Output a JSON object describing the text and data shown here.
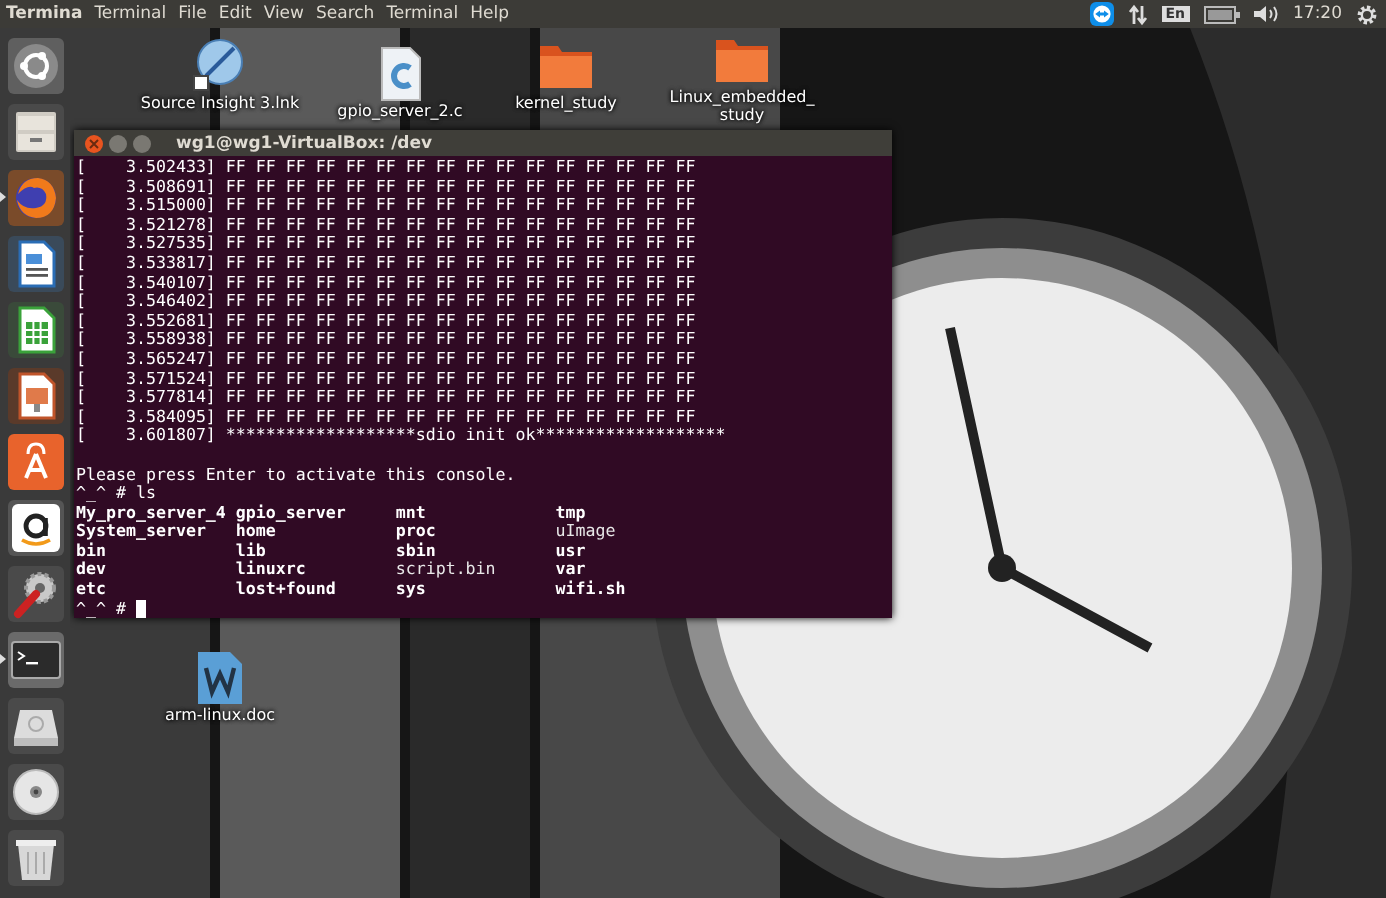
{
  "top_bar": {
    "app_name": "Termina",
    "menus": [
      "Terminal",
      "File",
      "Edit",
      "View",
      "Search",
      "Terminal",
      "Help"
    ],
    "keyboard": "En",
    "clock": "17:20"
  },
  "launcher": [
    {
      "running": false
    },
    {
      "running": false
    },
    {
      "running": true
    },
    {
      "running": false
    },
    {
      "running": false
    },
    {
      "running": false
    },
    {
      "running": false
    },
    {
      "running": false
    },
    {
      "running": false
    },
    {
      "running": true
    },
    {
      "running": false
    },
    {
      "running": false
    },
    {
      "running": false
    }
  ],
  "desktop_icons": [
    {
      "kind": "app",
      "label": "Source Insight 3.lnk"
    },
    {
      "kind": "source",
      "label": "gpio_server_2.c"
    },
    {
      "kind": "folder",
      "label": "kernel_study"
    },
    {
      "kind": "folder",
      "label": "Linux_embedded_ study"
    },
    {
      "kind": "doc",
      "label": "arm-linux.doc"
    }
  ],
  "terminal": {
    "title": "wg1@wg1-VirtualBox: /dev",
    "log": [
      "[    3.502433] FF FF FF FF FF FF FF FF FF FF FF FF FF FF FF FF",
      "[    3.508691] FF FF FF FF FF FF FF FF FF FF FF FF FF FF FF FF",
      "[    3.515000] FF FF FF FF FF FF FF FF FF FF FF FF FF FF FF FF",
      "[    3.521278] FF FF FF FF FF FF FF FF FF FF FF FF FF FF FF FF",
      "[    3.527535] FF FF FF FF FF FF FF FF FF FF FF FF FF FF FF FF",
      "[    3.533817] FF FF FF FF FF FF FF FF FF FF FF FF FF FF FF FF",
      "[    3.540107] FF FF FF FF FF FF FF FF FF FF FF FF FF FF FF FF",
      "[    3.546402] FF FF FF FF FF FF FF FF FF FF FF FF FF FF FF FF",
      "[    3.552681] FF FF FF FF FF FF FF FF FF FF FF FF FF FF FF FF",
      "[    3.558938] FF FF FF FF FF FF FF FF FF FF FF FF FF FF FF FF",
      "[    3.565247] FF FF FF FF FF FF FF FF FF FF FF FF FF FF FF FF",
      "[    3.571524] FF FF FF FF FF FF FF FF FF FF FF FF FF FF FF FF",
      "[    3.577814] FF FF FF FF FF FF FF FF FF FF FF FF FF FF FF FF",
      "[    3.584095] FF FF FF FF FF FF FF FF FF FF FF FF FF FF FF FF",
      "[    3.601807] *******************sdio init ok*******************"
    ],
    "message": "Please press Enter to activate this console.",
    "command": "^_^ # ls",
    "listing": [
      [
        {
          "text": "My_pro_server_4",
          "bold": true
        },
        {
          "text": "gpio_server",
          "bold": true
        },
        {
          "text": "mnt",
          "bold": true
        },
        {
          "text": "tmp",
          "bold": true
        }
      ],
      [
        {
          "text": "System_server",
          "bold": true
        },
        {
          "text": "home",
          "bold": true
        },
        {
          "text": "proc",
          "bold": true
        },
        {
          "text": "uImage",
          "bold": false
        }
      ],
      [
        {
          "text": "bin",
          "bold": true
        },
        {
          "text": "lib",
          "bold": true
        },
        {
          "text": "sbin",
          "bold": true
        },
        {
          "text": "usr",
          "bold": true
        }
      ],
      [
        {
          "text": "dev",
          "bold": true
        },
        {
          "text": "linuxrc",
          "bold": true
        },
        {
          "text": "script.bin",
          "bold": false
        },
        {
          "text": "var",
          "bold": true
        }
      ],
      [
        {
          "text": "etc",
          "bold": true
        },
        {
          "text": "lost+found",
          "bold": true
        },
        {
          "text": "sys",
          "bold": true
        },
        {
          "text": "wifi.sh",
          "bold": true
        }
      ]
    ],
    "prompt": "^_^ #"
  }
}
